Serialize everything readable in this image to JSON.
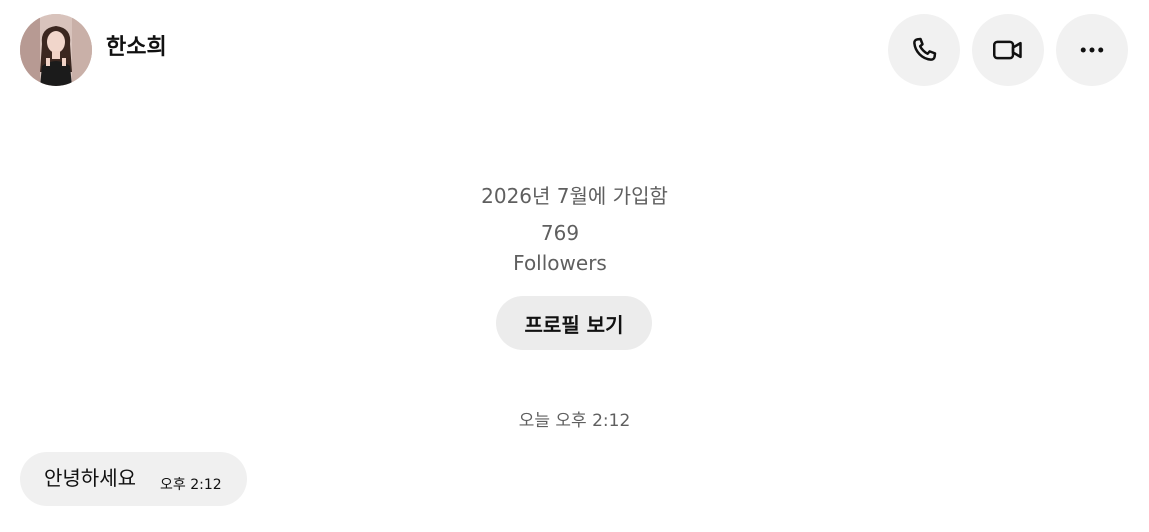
{
  "header": {
    "contact_name": "한소희",
    "avatar_icon": "profile-photo",
    "actions": [
      {
        "name": "call",
        "icon": "phone-icon"
      },
      {
        "name": "video-call",
        "icon": "video-camera-icon"
      },
      {
        "name": "more",
        "icon": "more-horizontal-icon"
      }
    ]
  },
  "profile_summary": {
    "joined_text": "2026년 7월에 가입함",
    "followers_count": "769",
    "followers_label": "Followers",
    "view_profile_label": "프로필 보기"
  },
  "conversation": {
    "day_separator": "오늘 오후 2:12",
    "messages": [
      {
        "text": "안녕하세요",
        "time": "오후 2:12",
        "direction": "incoming"
      }
    ]
  },
  "colors": {
    "background": "#ffffff",
    "button_bg": "#f1f1f1",
    "profile_button_bg": "#ececec",
    "bubble_bg": "#f0f0f0",
    "secondary_text": "#5f5f5f",
    "primary_text": "#111111"
  }
}
